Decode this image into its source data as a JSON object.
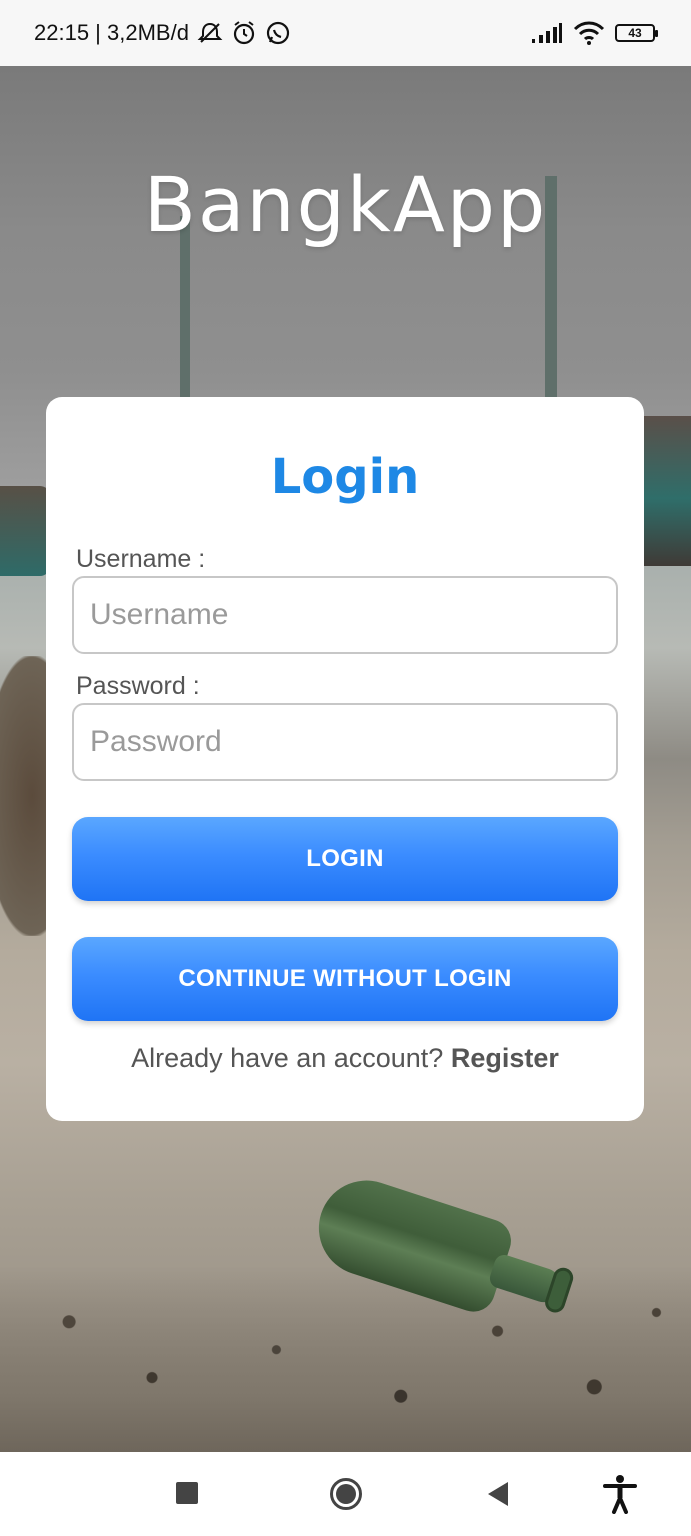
{
  "status_bar": {
    "time_info": "22:15 | 3,2MB/d",
    "battery": "43",
    "icons": [
      "mute-icon",
      "alarm-icon",
      "whatsapp-icon",
      "signal-icon",
      "wifi-icon",
      "battery-icon"
    ]
  },
  "app": {
    "title": "BangkApp"
  },
  "login_card": {
    "title": "Login",
    "username_label": "Username :",
    "username_placeholder": "Username",
    "username_value": "",
    "password_label": "Password :",
    "password_placeholder": "Password",
    "password_value": "",
    "login_button": "LOGIN",
    "guest_button": "CONTINUE WITHOUT LOGIN",
    "register_prompt": "Already have an account? ",
    "register_link": "Register"
  },
  "nav_bar": {
    "icons": [
      "recents-icon",
      "home-icon",
      "back-icon",
      "accessibility-icon"
    ]
  },
  "colors": {
    "accent": "#1e88e5",
    "button_gradient_top": "#5aa7ff",
    "button_gradient_bottom": "#1f74f5",
    "card_background": "#ffffff"
  }
}
